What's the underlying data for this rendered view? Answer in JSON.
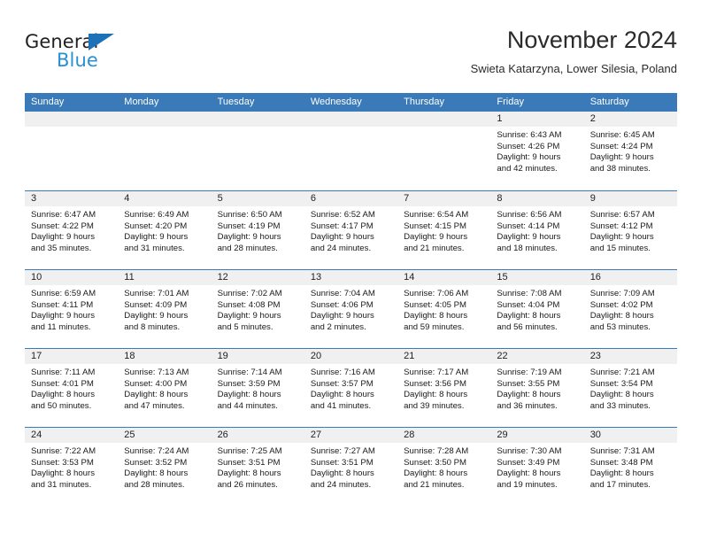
{
  "brand": {
    "name_top": "General",
    "name_bottom": "Blue",
    "triangle_color": "#1b72b8",
    "bottom_color": "#2b8fd4"
  },
  "header": {
    "title": "November 2024",
    "subtitle": "Swieta Katarzyna, Lower Silesia, Poland"
  },
  "theme": {
    "header_blue": "#3a7ab8",
    "day_strip_gray": "#f0f0f0",
    "text": "#1a1a1a"
  },
  "weekdays": [
    "Sunday",
    "Monday",
    "Tuesday",
    "Wednesday",
    "Thursday",
    "Friday",
    "Saturday"
  ],
  "weeks": [
    [
      {
        "day": "",
        "sunrise": "",
        "sunset": "",
        "daylight1": "",
        "daylight2": "",
        "empty": true
      },
      {
        "day": "",
        "sunrise": "",
        "sunset": "",
        "daylight1": "",
        "daylight2": "",
        "empty": true
      },
      {
        "day": "",
        "sunrise": "",
        "sunset": "",
        "daylight1": "",
        "daylight2": "",
        "empty": true
      },
      {
        "day": "",
        "sunrise": "",
        "sunset": "",
        "daylight1": "",
        "daylight2": "",
        "empty": true
      },
      {
        "day": "",
        "sunrise": "",
        "sunset": "",
        "daylight1": "",
        "daylight2": "",
        "empty": true
      },
      {
        "day": "1",
        "sunrise": "Sunrise: 6:43 AM",
        "sunset": "Sunset: 4:26 PM",
        "daylight1": "Daylight: 9 hours",
        "daylight2": "and 42 minutes."
      },
      {
        "day": "2",
        "sunrise": "Sunrise: 6:45 AM",
        "sunset": "Sunset: 4:24 PM",
        "daylight1": "Daylight: 9 hours",
        "daylight2": "and 38 minutes."
      }
    ],
    [
      {
        "day": "3",
        "sunrise": "Sunrise: 6:47 AM",
        "sunset": "Sunset: 4:22 PM",
        "daylight1": "Daylight: 9 hours",
        "daylight2": "and 35 minutes."
      },
      {
        "day": "4",
        "sunrise": "Sunrise: 6:49 AM",
        "sunset": "Sunset: 4:20 PM",
        "daylight1": "Daylight: 9 hours",
        "daylight2": "and 31 minutes."
      },
      {
        "day": "5",
        "sunrise": "Sunrise: 6:50 AM",
        "sunset": "Sunset: 4:19 PM",
        "daylight1": "Daylight: 9 hours",
        "daylight2": "and 28 minutes."
      },
      {
        "day": "6",
        "sunrise": "Sunrise: 6:52 AM",
        "sunset": "Sunset: 4:17 PM",
        "daylight1": "Daylight: 9 hours",
        "daylight2": "and 24 minutes."
      },
      {
        "day": "7",
        "sunrise": "Sunrise: 6:54 AM",
        "sunset": "Sunset: 4:15 PM",
        "daylight1": "Daylight: 9 hours",
        "daylight2": "and 21 minutes."
      },
      {
        "day": "8",
        "sunrise": "Sunrise: 6:56 AM",
        "sunset": "Sunset: 4:14 PM",
        "daylight1": "Daylight: 9 hours",
        "daylight2": "and 18 minutes."
      },
      {
        "day": "9",
        "sunrise": "Sunrise: 6:57 AM",
        "sunset": "Sunset: 4:12 PM",
        "daylight1": "Daylight: 9 hours",
        "daylight2": "and 15 minutes."
      }
    ],
    [
      {
        "day": "10",
        "sunrise": "Sunrise: 6:59 AM",
        "sunset": "Sunset: 4:11 PM",
        "daylight1": "Daylight: 9 hours",
        "daylight2": "and 11 minutes."
      },
      {
        "day": "11",
        "sunrise": "Sunrise: 7:01 AM",
        "sunset": "Sunset: 4:09 PM",
        "daylight1": "Daylight: 9 hours",
        "daylight2": "and 8 minutes."
      },
      {
        "day": "12",
        "sunrise": "Sunrise: 7:02 AM",
        "sunset": "Sunset: 4:08 PM",
        "daylight1": "Daylight: 9 hours",
        "daylight2": "and 5 minutes."
      },
      {
        "day": "13",
        "sunrise": "Sunrise: 7:04 AM",
        "sunset": "Sunset: 4:06 PM",
        "daylight1": "Daylight: 9 hours",
        "daylight2": "and 2 minutes."
      },
      {
        "day": "14",
        "sunrise": "Sunrise: 7:06 AM",
        "sunset": "Sunset: 4:05 PM",
        "daylight1": "Daylight: 8 hours",
        "daylight2": "and 59 minutes."
      },
      {
        "day": "15",
        "sunrise": "Sunrise: 7:08 AM",
        "sunset": "Sunset: 4:04 PM",
        "daylight1": "Daylight: 8 hours",
        "daylight2": "and 56 minutes."
      },
      {
        "day": "16",
        "sunrise": "Sunrise: 7:09 AM",
        "sunset": "Sunset: 4:02 PM",
        "daylight1": "Daylight: 8 hours",
        "daylight2": "and 53 minutes."
      }
    ],
    [
      {
        "day": "17",
        "sunrise": "Sunrise: 7:11 AM",
        "sunset": "Sunset: 4:01 PM",
        "daylight1": "Daylight: 8 hours",
        "daylight2": "and 50 minutes."
      },
      {
        "day": "18",
        "sunrise": "Sunrise: 7:13 AM",
        "sunset": "Sunset: 4:00 PM",
        "daylight1": "Daylight: 8 hours",
        "daylight2": "and 47 minutes."
      },
      {
        "day": "19",
        "sunrise": "Sunrise: 7:14 AM",
        "sunset": "Sunset: 3:59 PM",
        "daylight1": "Daylight: 8 hours",
        "daylight2": "and 44 minutes."
      },
      {
        "day": "20",
        "sunrise": "Sunrise: 7:16 AM",
        "sunset": "Sunset: 3:57 PM",
        "daylight1": "Daylight: 8 hours",
        "daylight2": "and 41 minutes."
      },
      {
        "day": "21",
        "sunrise": "Sunrise: 7:17 AM",
        "sunset": "Sunset: 3:56 PM",
        "daylight1": "Daylight: 8 hours",
        "daylight2": "and 39 minutes."
      },
      {
        "day": "22",
        "sunrise": "Sunrise: 7:19 AM",
        "sunset": "Sunset: 3:55 PM",
        "daylight1": "Daylight: 8 hours",
        "daylight2": "and 36 minutes."
      },
      {
        "day": "23",
        "sunrise": "Sunrise: 7:21 AM",
        "sunset": "Sunset: 3:54 PM",
        "daylight1": "Daylight: 8 hours",
        "daylight2": "and 33 minutes."
      }
    ],
    [
      {
        "day": "24",
        "sunrise": "Sunrise: 7:22 AM",
        "sunset": "Sunset: 3:53 PM",
        "daylight1": "Daylight: 8 hours",
        "daylight2": "and 31 minutes."
      },
      {
        "day": "25",
        "sunrise": "Sunrise: 7:24 AM",
        "sunset": "Sunset: 3:52 PM",
        "daylight1": "Daylight: 8 hours",
        "daylight2": "and 28 minutes."
      },
      {
        "day": "26",
        "sunrise": "Sunrise: 7:25 AM",
        "sunset": "Sunset: 3:51 PM",
        "daylight1": "Daylight: 8 hours",
        "daylight2": "and 26 minutes."
      },
      {
        "day": "27",
        "sunrise": "Sunrise: 7:27 AM",
        "sunset": "Sunset: 3:51 PM",
        "daylight1": "Daylight: 8 hours",
        "daylight2": "and 24 minutes."
      },
      {
        "day": "28",
        "sunrise": "Sunrise: 7:28 AM",
        "sunset": "Sunset: 3:50 PM",
        "daylight1": "Daylight: 8 hours",
        "daylight2": "and 21 minutes."
      },
      {
        "day": "29",
        "sunrise": "Sunrise: 7:30 AM",
        "sunset": "Sunset: 3:49 PM",
        "daylight1": "Daylight: 8 hours",
        "daylight2": "and 19 minutes."
      },
      {
        "day": "30",
        "sunrise": "Sunrise: 7:31 AM",
        "sunset": "Sunset: 3:48 PM",
        "daylight1": "Daylight: 8 hours",
        "daylight2": "and 17 minutes."
      }
    ]
  ]
}
